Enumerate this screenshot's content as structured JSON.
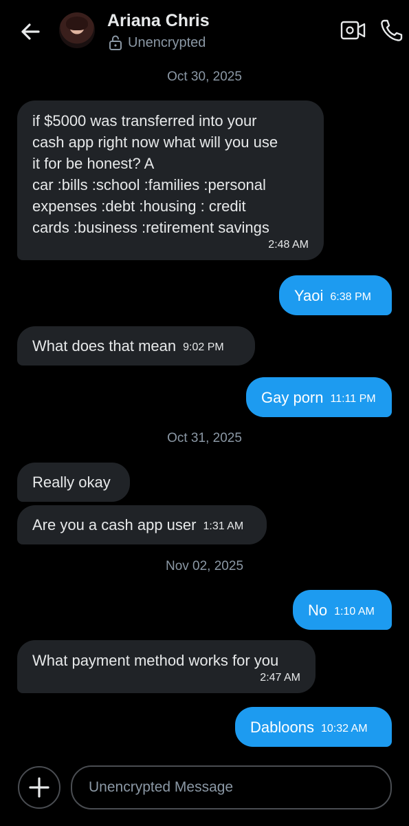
{
  "header": {
    "contact_name": "Ariana Chris",
    "encryption_status": "Unencrypted"
  },
  "messages": [
    {
      "date": "Oct 30, 2025"
    },
    {
      "direction": "incoming",
      "lines": [
        "if $5000 was transferred into your",
        "cash app right now what will you use",
        "it for be honest? A",
        "car :bills :school  :families  :personal",
        "expenses :debt :housing : credit",
        "cards :business :retirement savings"
      ],
      "time": "2:48 AM"
    },
    {
      "direction": "outgoing",
      "text": "Yaoi",
      "time": "6:38 PM"
    },
    {
      "direction": "incoming",
      "text": "What does that mean",
      "time": "9:02 PM"
    },
    {
      "direction": "outgoing",
      "text": "Gay porn",
      "time": "11:11 PM"
    },
    {
      "date": "Oct 31, 2025"
    },
    {
      "direction": "incoming",
      "text": "Really okay",
      "time": ""
    },
    {
      "direction": "incoming",
      "text": "Are you a cash app user",
      "time": "1:31 AM"
    },
    {
      "date": "Nov 02, 2025"
    },
    {
      "direction": "outgoing",
      "text": "No",
      "time": "1:10 AM"
    },
    {
      "direction": "incoming",
      "text": "What payment method works for you",
      "time": "2:47 AM"
    },
    {
      "direction": "outgoing",
      "text": "Dabloons",
      "time": "10:32 AM"
    }
  ],
  "composer": {
    "placeholder": "Unencrypted Message"
  },
  "icons": {
    "back": "arrow-left-icon",
    "lock": "unlocked-padlock-icon",
    "video": "video-camera-icon",
    "call": "phone-icon",
    "add": "plus-icon"
  },
  "colors": {
    "background": "#000000",
    "incoming_bubble": "#202327",
    "outgoing_bubble": "#1d9bf0",
    "secondary_text": "#8b98a5"
  }
}
